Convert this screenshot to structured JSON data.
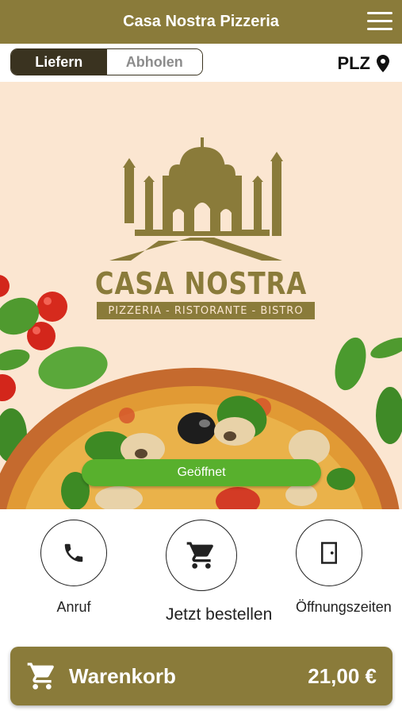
{
  "header": {
    "title": "Casa Nostra Pizzeria",
    "menu_icon": "hamburger-menu-icon"
  },
  "order_mode": {
    "options": [
      "Liefern",
      "Abholen"
    ],
    "selected": "Liefern"
  },
  "location": {
    "label": "PLZ",
    "icon": "map-pin-icon"
  },
  "hero": {
    "logo_name": "CASA NOSTRA",
    "logo_tagline": "PIZZERIA - RISTORANTE - BISTRO",
    "status": "Geöffnet",
    "status_color": "#58b02d"
  },
  "actions": [
    {
      "label": "Anruf",
      "icon": "phone-icon"
    },
    {
      "label": "Jetzt bestellen",
      "icon": "shopping-cart-icon"
    },
    {
      "label": "Öffnungszeiten",
      "icon": "door-icon"
    }
  ],
  "cart": {
    "label": "Warenkorb",
    "total": "21,00 €",
    "icon": "shopping-cart-icon"
  },
  "colors": {
    "brand": "#8a7b3a",
    "dark": "#3a3320",
    "hero_bg": "#fbe6d1",
    "open_green": "#58b02d"
  }
}
